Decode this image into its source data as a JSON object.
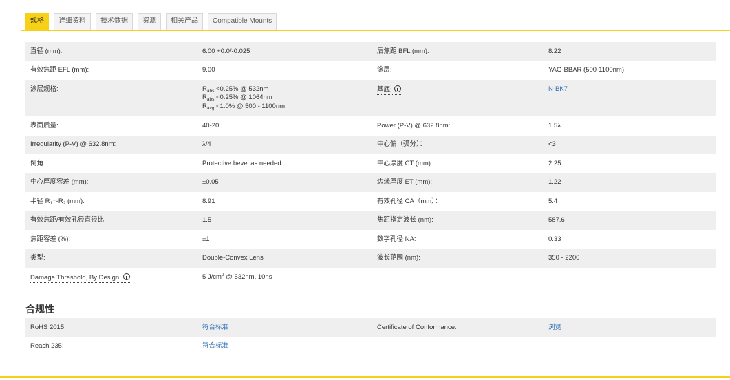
{
  "colors": {
    "accent": "#f7d117",
    "row_alt": "#efefef",
    "text": "#333333",
    "link": "#2f6db3",
    "tab_bg": "#f3f3f3",
    "tab_border": "#d8d8d8",
    "tab_text": "#5a5a5a"
  },
  "tabs": [
    {
      "label": "规格",
      "active": true
    },
    {
      "label": "详细资料",
      "active": false
    },
    {
      "label": "技术数据",
      "active": false
    },
    {
      "label": "资源",
      "active": false
    },
    {
      "label": "相关产品",
      "active": false
    },
    {
      "label": "Compatible Mounts",
      "active": false
    }
  ],
  "specs": {
    "rows": [
      {
        "label1": "直径 (mm):",
        "value1": "6.00 +0.0/-0.025",
        "label2": "后焦距 BFL (mm):",
        "value2": "8.22"
      },
      {
        "label1": "有效焦距 EFL (mm):",
        "value1": "9.00",
        "label2": "涂层:",
        "value2": "YAG-BBAR (500-1100nm)"
      },
      {
        "label1": "涂层规格:",
        "value1": [
          {
            "r": "R",
            "sub": "abs",
            "rest": " <0.25% @ 532nm"
          },
          {
            "r": "R",
            "sub": "abs",
            "rest": " <0.25% @ 1064nm"
          },
          {
            "r": "R",
            "sub": "avg",
            "rest": " <1.0% @ 500 - 1100nm"
          }
        ],
        "label2": "基底:",
        "label2_icon": "info-icon",
        "value2": "N-BK7"
      },
      {
        "label1": "表面质量:",
        "value1": "40-20",
        "label2": "Power (P-V) @ 632.8nm:",
        "value2": "1.5λ"
      },
      {
        "label1": "Irregularity (P-V) @ 632.8nm:",
        "value1": "λ/4",
        "label2": "中心偏（弧分）：",
        "value2": "<3"
      },
      {
        "label1": "倒角:",
        "value1": "Protective bevel as needed",
        "label2": "中心厚度 CT (mm):",
        "value2": "2.25"
      },
      {
        "label1": "中心厚度容差 (mm):",
        "value1": "±0.05",
        "label2": "边缘厚度 ET (mm):",
        "value2": "1.22"
      },
      {
        "label1": {
          "pre": "半径 R",
          "sub1": "1",
          "mid": "=-R",
          "sub2": "2",
          "post": " (mm):"
        },
        "value1": "8.91",
        "label2": "有效孔径 CA（mm）：",
        "value2": "5.4"
      },
      {
        "label1": "有效焦距/有效孔径直径比:",
        "value1": "1.5",
        "label2": "焦距指定波长 (nm):",
        "value2": "587.6"
      },
      {
        "label1": "焦距容差 (%):",
        "value1": "±1",
        "label2": "数字孔径 NA:",
        "value2": "0.33"
      },
      {
        "label1": "类型:",
        "value1": "Double-Convex Lens",
        "label2": "波长范围 (nm):",
        "value2": "350 - 2200"
      },
      {
        "label1": "Damage Threshold, By Design:",
        "label1_icon": "info-icon",
        "value1": {
          "pre": "5 J/cm",
          "sup": "2",
          "post": " @ 532nm, 10ns"
        }
      }
    ]
  },
  "compliance": {
    "title": "合规性",
    "rows": [
      {
        "label1": "RoHS 2015:",
        "value1": "符合标准",
        "label2": "Certificate of Conformance:",
        "value2": "浏览"
      },
      {
        "label1": "Reach 235:",
        "value1": "符合标准"
      }
    ]
  }
}
